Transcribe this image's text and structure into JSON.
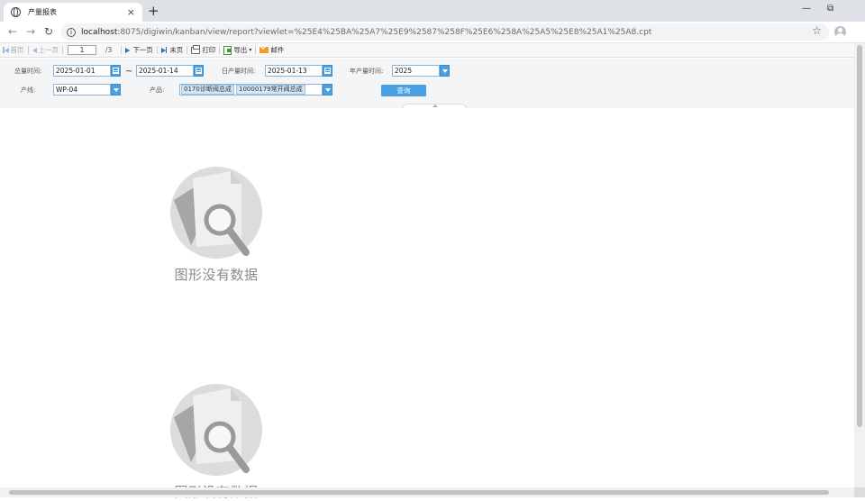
{
  "browser": {
    "tab_title": "产量报表",
    "tab_close": "×",
    "new_tab": "+",
    "minimize": "—",
    "restore": "⧉",
    "url_host": "localhost",
    "url_rest": ":8075/digiwin/kanban/view/report?viewlet=%25E4%25BA%25A7%25E9%2587%258F%25E6%258A%25A5%25E8%25A1%25A8.cpt"
  },
  "toolbar": {
    "first_page": "首页",
    "prev_page": "上一页",
    "page_number": "1",
    "page_total": "/3",
    "next_page": "下一页",
    "last_page": "末页",
    "print": "打印",
    "export": "导出",
    "export_arrow": "▾",
    "email": "邮件"
  },
  "params": {
    "total_time_label": "总量时间:",
    "total_time_start": "2025-01-01",
    "tilde": "~",
    "total_time_end": "2025-01-14",
    "daily_time_label": "日产量时间:",
    "daily_time_value": "2025-01-13",
    "yearly_time_label": "年产量时间:",
    "yearly_time_value": "2025",
    "line_label": "产线:",
    "line_value": "WP-04",
    "product_label": "产品:",
    "product_tags": [
      "0170诊断阀总成",
      "10000179常开阀总成"
    ],
    "query_button": "查询"
  },
  "content": {
    "empty_text_1": "图形没有数据",
    "empty_text_2": "图形没有数据"
  }
}
